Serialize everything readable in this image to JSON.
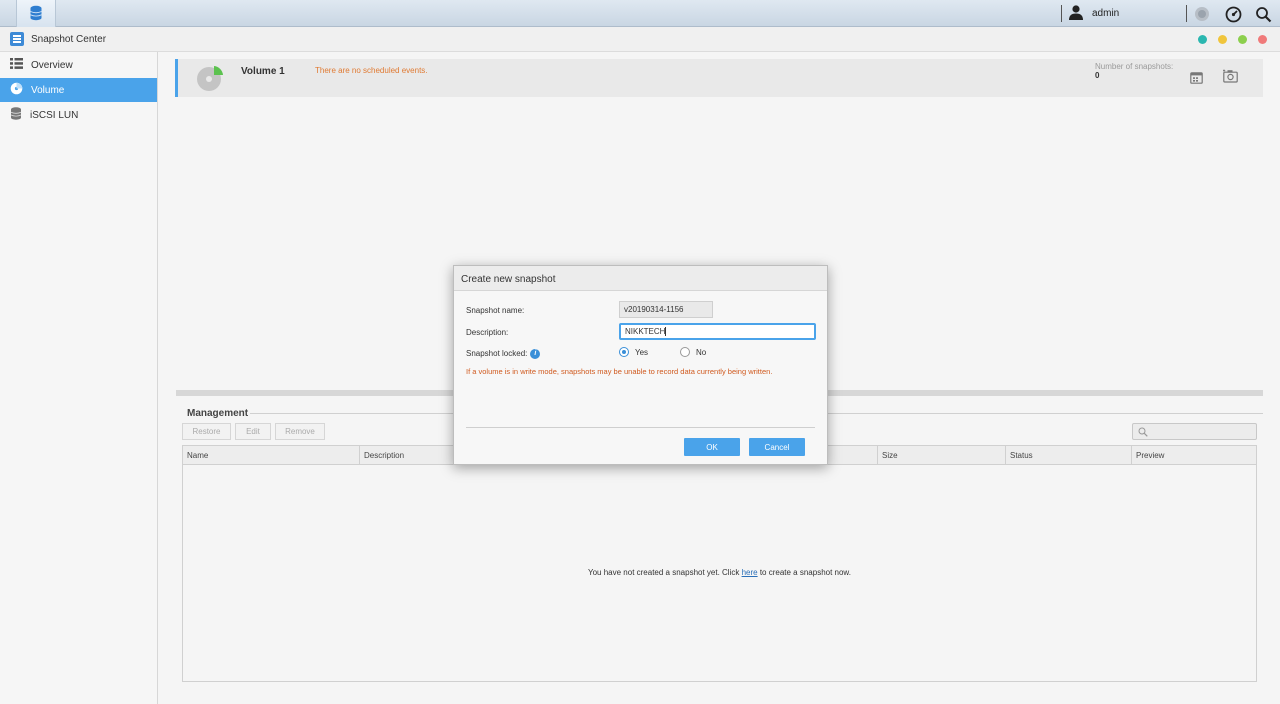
{
  "taskbar": {
    "app_icon": "database-stack-icon",
    "user_icon": "user-silhouette-icon",
    "username": "admin",
    "icons": [
      "notification-circle-icon",
      "dashboard-gauge-icon",
      "search-icon"
    ]
  },
  "window": {
    "title": "Snapshot Center",
    "title_icon": "snapshot-center-icon",
    "controls": [
      "#2bb7b0",
      "#f0c53c",
      "#8ccf4d",
      "#f07a7a"
    ]
  },
  "sidebar": {
    "items": [
      {
        "label": "Overview",
        "icon": "list-overview-icon"
      },
      {
        "label": "Volume",
        "icon": "volume-disk-icon",
        "active": true
      },
      {
        "label": "iSCSI LUN",
        "icon": "database-icon"
      }
    ]
  },
  "volume": {
    "name": "Volume 1",
    "events": "There are no scheduled events.",
    "count_label": "Number of snapshots:",
    "count": "0",
    "icons": [
      "calendar-schedule-icon",
      "camera-snapshot-icon"
    ]
  },
  "management": {
    "title": "Management",
    "buttons": {
      "restore": "Restore",
      "edit": "Edit",
      "remove": "Remove"
    },
    "search_icon": "search-icon",
    "columns": [
      "Name",
      "Description",
      "Size",
      "Status",
      "Preview"
    ],
    "empty_prefix": "You have not created a snapshot yet. Click ",
    "empty_link": "here",
    "empty_suffix": " to create a snapshot now."
  },
  "dialog": {
    "title": "Create new snapshot",
    "name_label": "Snapshot name:",
    "name_value": "v20190314-1156",
    "desc_label": "Description:",
    "desc_value": "NIKKTECH",
    "locked_label": "Snapshot locked:",
    "yes": "Yes",
    "no": "No",
    "warning": "If a volume is in write mode, snapshots may be unable to record data currently being written.",
    "ok": "OK",
    "cancel": "Cancel"
  }
}
